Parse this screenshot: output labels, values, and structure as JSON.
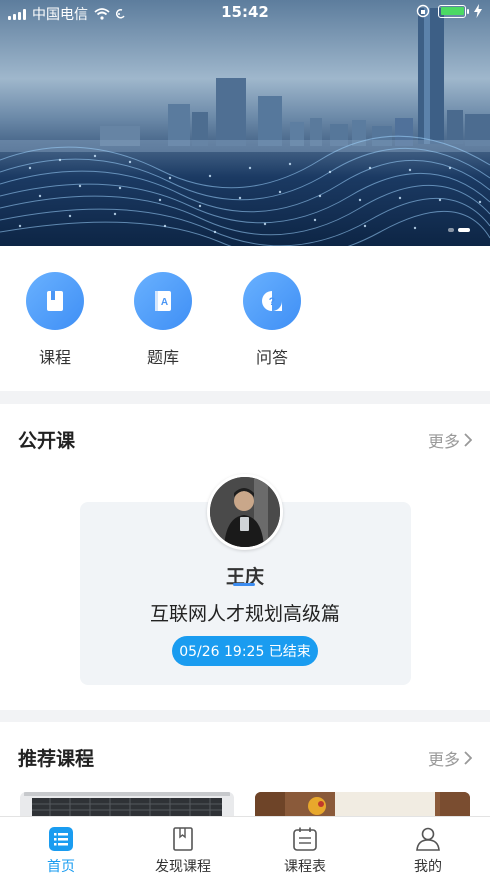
{
  "status_bar": {
    "carrier": "中国电信",
    "time": "15:42",
    "battery_color": "#4cd964"
  },
  "banner": {
    "image": "city-skyline-digital-wave",
    "slide_count": 2,
    "active_slide": 2
  },
  "quick_nav": [
    {
      "label": "课程",
      "icon": "book-icon"
    },
    {
      "label": "题库",
      "icon": "question-bank-icon"
    },
    {
      "label": "问答",
      "icon": "qa-icon"
    }
  ],
  "open_courses": {
    "title": "公开课",
    "more_label": "更多",
    "card": {
      "teacher": "王庆",
      "course_title": "互联网人才规划高级篇",
      "time_status": "05/26 19:25 已结束"
    }
  },
  "recommended": {
    "title": "推荐课程",
    "more_label": "更多"
  },
  "tab_bar": {
    "active_color": "#1a9cf0",
    "tabs": [
      {
        "label": "首页",
        "icon": "home-list-icon",
        "active": true
      },
      {
        "label": "发现课程",
        "icon": "discover-book-icon",
        "active": false
      },
      {
        "label": "课程表",
        "icon": "schedule-icon",
        "active": false
      },
      {
        "label": "我的",
        "icon": "profile-icon",
        "active": false
      }
    ]
  }
}
